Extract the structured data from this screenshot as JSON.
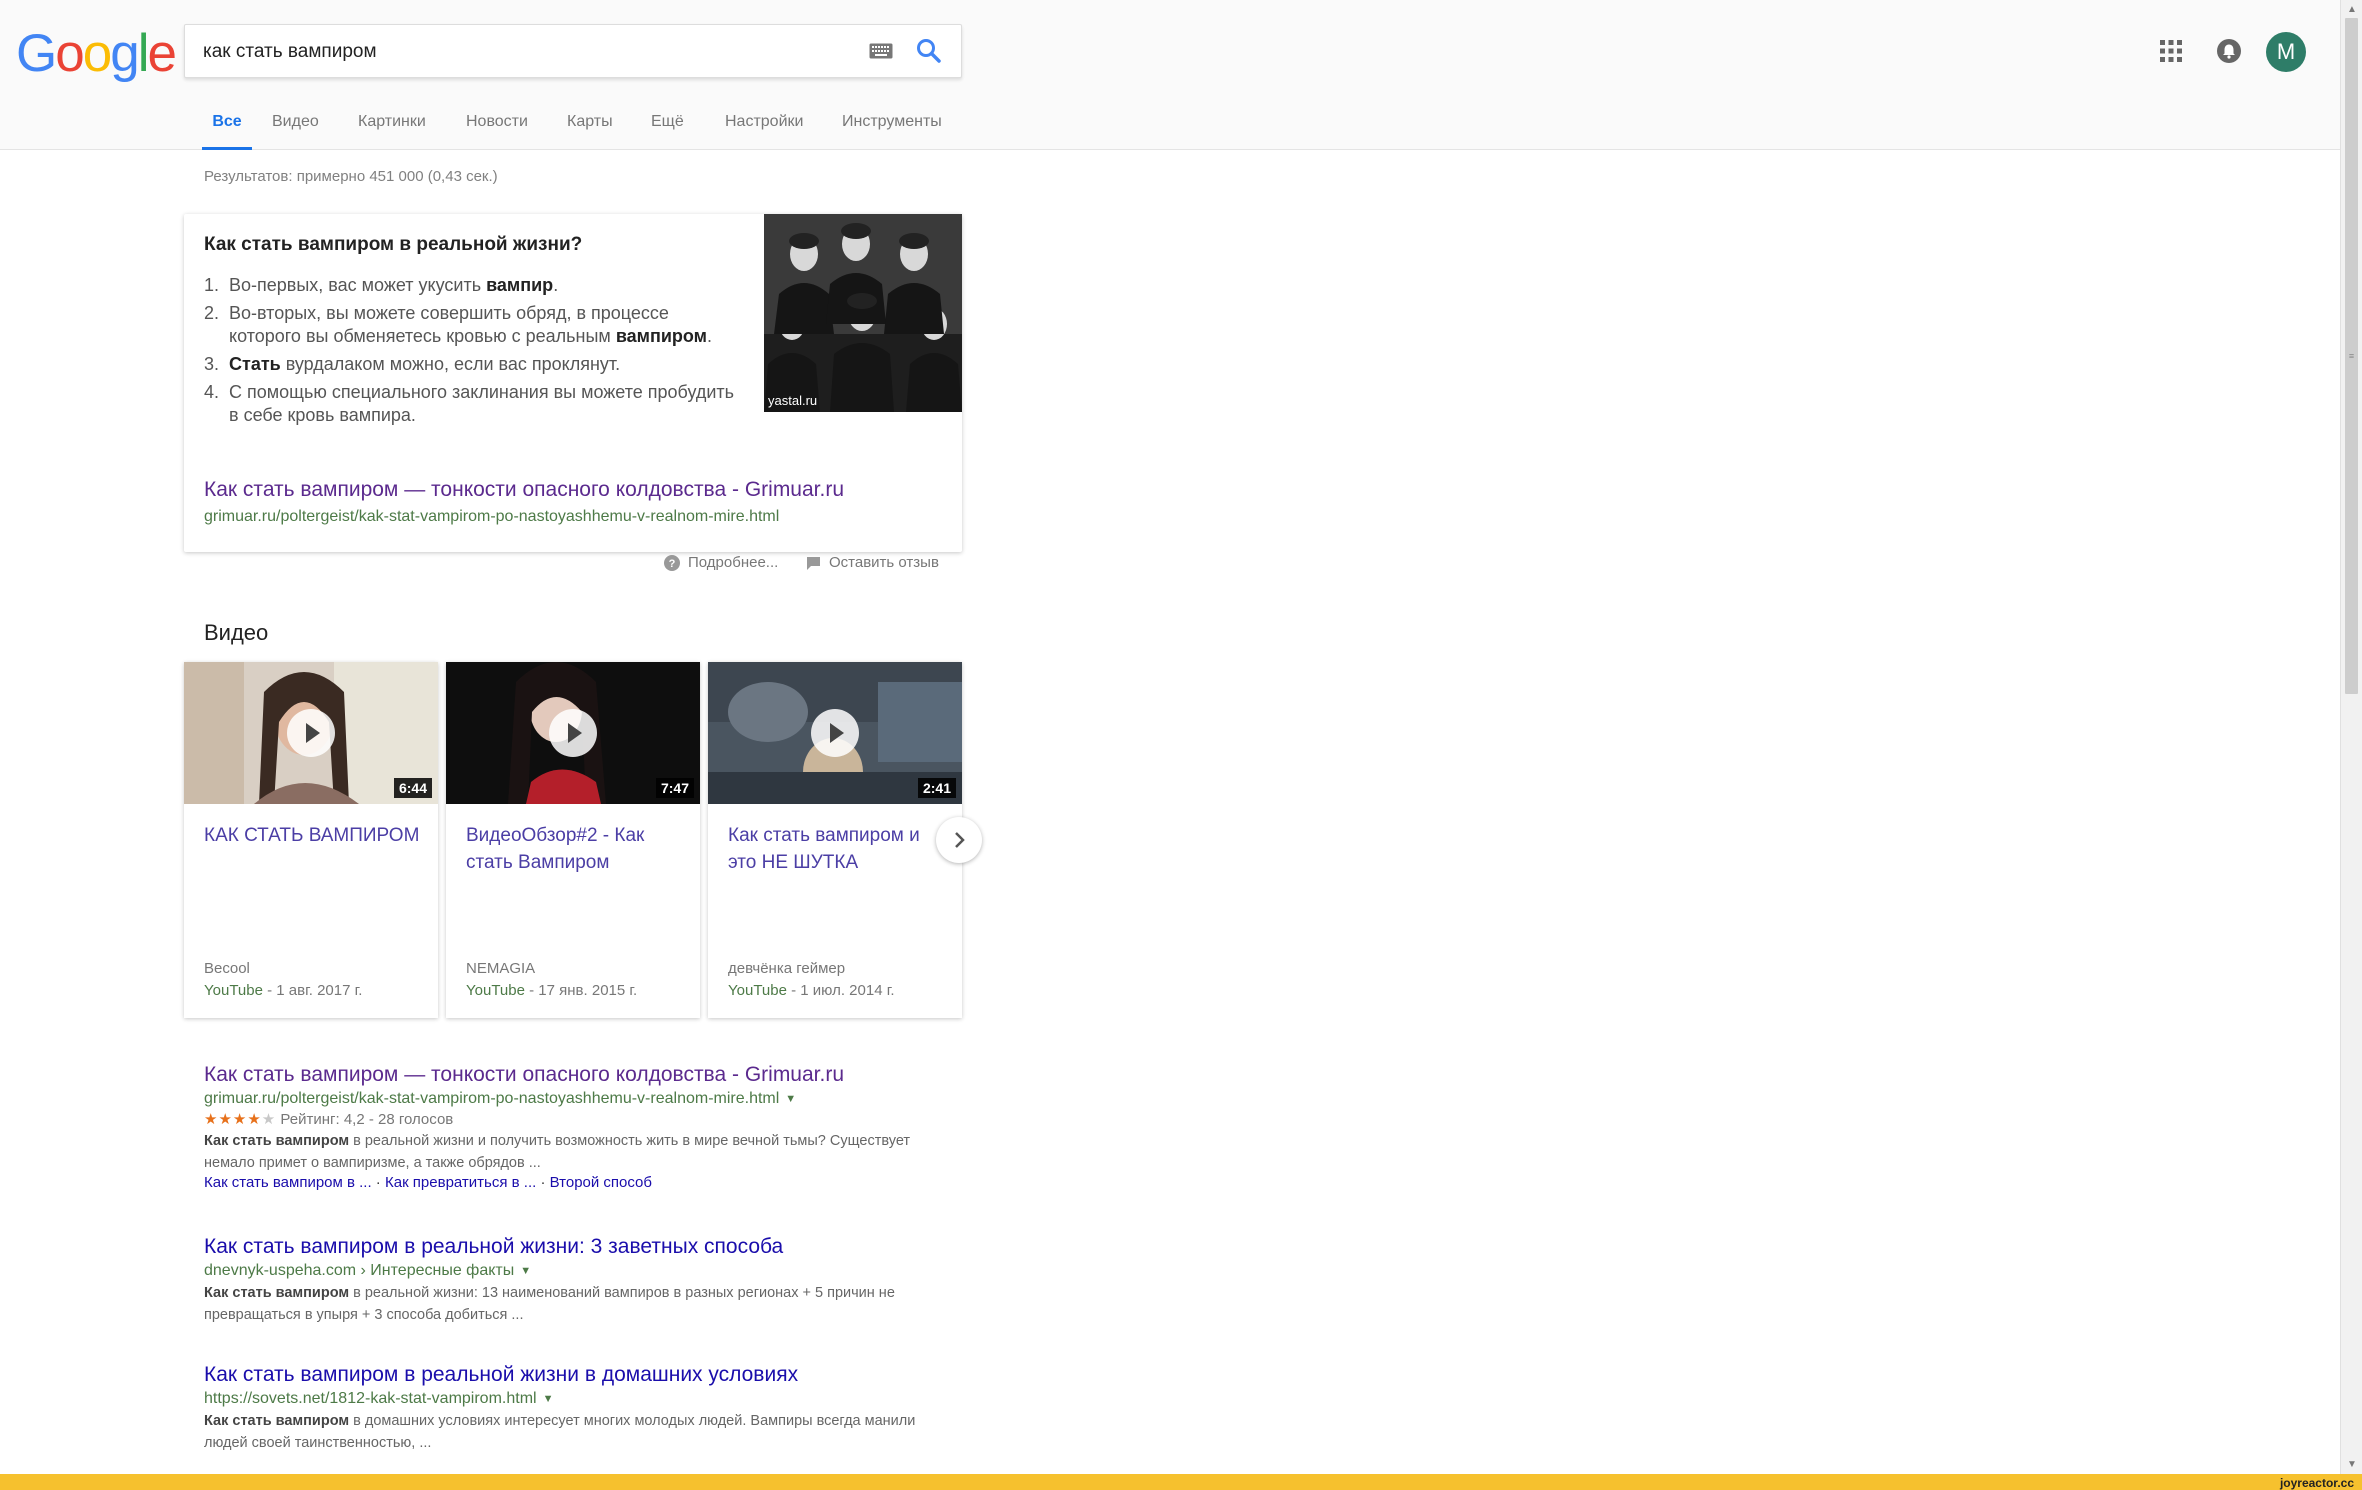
{
  "logo": {
    "letters": [
      "G",
      "o",
      "o",
      "g",
      "l",
      "e"
    ],
    "colors": [
      "#4285F4",
      "#EA4335",
      "#FBBC05",
      "#4285F4",
      "#34A853",
      "#EA4335"
    ]
  },
  "search": {
    "value": "как стать вампиром"
  },
  "header": {
    "avatar_letter": "M"
  },
  "tabs": [
    "Все",
    "Видео",
    "Картинки",
    "Новости",
    "Карты",
    "Ещё",
    "Настройки",
    "Инструменты"
  ],
  "stats": "Результатов: примерно 451 000 (0,43 сек.)",
  "snippet": {
    "question": "Как стать вампиром в реальной жизни?",
    "items": [
      {
        "num": "1.",
        "pre": "Во-первых, вас может укусить ",
        "bold": "вампир",
        "post": "."
      },
      {
        "num": "2.",
        "pre": "Во-вторых, вы можете совершить обряд, в процессе которого вы обменяетесь кровью с реальным ",
        "bold": "вампиром",
        "post": "."
      },
      {
        "num": "3.",
        "pre": "",
        "bold": "Стать",
        "post": " вурдалаком можно, если вас проклянут."
      },
      {
        "num": "4.",
        "pre": "С помощью специального заклинания вы можете пробудить в себе кровь вампира.",
        "bold": "",
        "post": ""
      }
    ],
    "image_source": "yastal.ru",
    "link_title": "Как стать вампиром — тонкости опасного колдовства - Grimuar.ru",
    "link_url": "grimuar.ru/poltergeist/kak-stat-vampirom-po-nastoyashhemu-v-realnom-mire.html"
  },
  "feedback": {
    "more": "Подробнее...",
    "leave": "Оставить отзыв"
  },
  "videos": {
    "heading": "Видео",
    "items": [
      {
        "title": "КАК СТАТЬ ВАМПИРОМ",
        "duration": "6:44",
        "author": "Becool",
        "source": "YouTube",
        "date": " - 1 авг. 2017 г."
      },
      {
        "title": "ВидеоОбзор#2 - Как стать Вампиром",
        "duration": "7:47",
        "author": "NEMAGIA",
        "source": "YouTube",
        "date": " - 17 янв. 2015 г."
      },
      {
        "title": "Как стать вампиром и это НЕ ШУТКА",
        "duration": "2:41",
        "author": "девчёнка геймер",
        "source": "YouTube",
        "date": " - 1 июл. 2014 г."
      }
    ]
  },
  "results": [
    {
      "title": "Как стать вампиром — тонкости опасного колдовства - Grimuar.ru",
      "url": "grimuar.ru/poltergeist/kak-stat-vampirom-po-nastoyashhemu-v-realnom-mire.html",
      "rating_stars": 4,
      "rating_text": "Рейтинг: 4,2 - 28 голосов",
      "desc_bold": "Как стать вампиром",
      "desc": " в реальной жизни и получить возможность жить в мире вечной тьмы? Существует немало примет о вампиризме, а также обрядов ...",
      "sitelinks": [
        "Как стать вампиром в ...",
        "Как превратиться в ...",
        "Второй способ"
      ]
    },
    {
      "title": "Как стать вампиром в реальной жизни: 3 заветных способа",
      "url": "dnevnyk-uspeha.com › Интересные факты",
      "desc_bold": "Как стать вампиром",
      "desc": " в реальной жизни: 13 наименований вампиров в разных регионах + 5 причин не превращаться в упыря + 3 способа добиться ..."
    },
    {
      "title": "Как стать вампиром в реальной жизни в домашних условиях",
      "url": "https://sovets.net/1812-kak-stat-vampirom.html",
      "desc_bold": "Как стать вампиром",
      "desc": " в домашних условиях интересует многих молодых людей. Вампиры всегда манили людей своей таинственностью, ..."
    }
  ],
  "colors": {
    "link_visited": "#5b2a8e",
    "link": "#1a0dab",
    "url": "#4d7a47",
    "accent": "#1a73e8",
    "footer": "#f6c12e"
  },
  "footer_brand": "joyreactor.cc"
}
